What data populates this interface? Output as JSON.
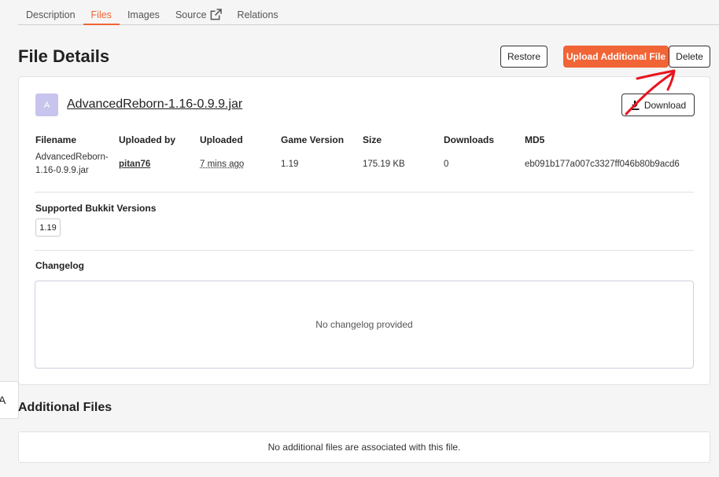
{
  "tabs": [
    {
      "label": "Description"
    },
    {
      "label": "Files",
      "active": true
    },
    {
      "label": "Images"
    },
    {
      "label": "Source",
      "icon": "external-link-icon"
    },
    {
      "label": "Relations"
    }
  ],
  "header": {
    "title": "File Details",
    "restore_label": "Restore",
    "upload_label": "Upload Additional File",
    "delete_label": "Delete"
  },
  "file": {
    "avatar_letter": "A",
    "name": "AdvancedReborn-1.16-0.9.9.jar",
    "download_label": "Download",
    "columns": {
      "filename": {
        "head": "Filename",
        "value": "AdvancedReborn-1.16-0.9.9.jar"
      },
      "uploaded_by": {
        "head": "Uploaded by",
        "value": "pitan76"
      },
      "uploaded": {
        "head": "Uploaded",
        "value": "7 mins ago"
      },
      "game_version": {
        "head": "Game Version",
        "value": "1.19"
      },
      "size": {
        "head": "Size",
        "value": "175.19 KB"
      },
      "downloads": {
        "head": "Downloads",
        "value": "0"
      },
      "md5": {
        "head": "MD5",
        "value": "eb091b177a007c3327ff046b80b9acd6"
      }
    },
    "supported_label": "Supported Bukkit Versions",
    "supported_versions": [
      "1.19"
    ],
    "changelog_label": "Changelog",
    "changelog_empty": "No changelog provided"
  },
  "side_tab": {
    "letter": "A"
  },
  "additional": {
    "title": "Additional Files",
    "empty": "No additional files are associated with this file."
  },
  "colors": {
    "accent": "#f16436",
    "avatar": "#c7c5ed",
    "annotation": "#e8141e"
  }
}
